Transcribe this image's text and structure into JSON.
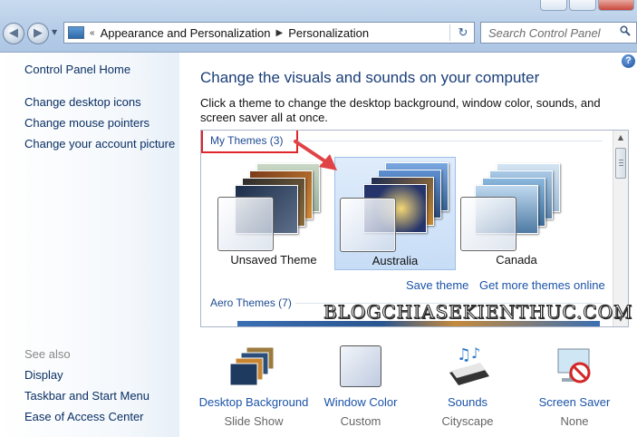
{
  "address": {
    "breadcrumb": [
      "Appearance and Personalization",
      "Personalization"
    ],
    "search_placeholder": "Search Control Panel"
  },
  "sidebar": {
    "home": "Control Panel Home",
    "links": [
      "Change desktop icons",
      "Change mouse pointers",
      "Change your account picture"
    ],
    "see_also_label": "See also",
    "see_also": [
      "Display",
      "Taskbar and Start Menu",
      "Ease of Access Center"
    ]
  },
  "main": {
    "title": "Change the visuals and sounds on your computer",
    "description": "Click a theme to change the desktop background, window color, sounds, and screen saver all at once."
  },
  "themes": {
    "my_themes_header": "My Themes (3)",
    "items": [
      {
        "name": "Unsaved Theme",
        "selected": false
      },
      {
        "name": "Australia",
        "selected": true
      },
      {
        "name": "Canada",
        "selected": false
      }
    ],
    "save_theme": "Save theme",
    "get_more": "Get more themes online",
    "aero_header": "Aero Themes (7)"
  },
  "watermark": "BLOGCHIASEKIENTHUC.COM",
  "customizations": [
    {
      "label": "Desktop Background",
      "value": "Slide Show",
      "icon": "desktop-background-icon"
    },
    {
      "label": "Window Color",
      "value": "Custom",
      "icon": "window-color-icon"
    },
    {
      "label": "Sounds",
      "value": "Cityscape",
      "icon": "sounds-icon"
    },
    {
      "label": "Screen Saver",
      "value": "None",
      "icon": "screen-saver-icon"
    }
  ],
  "colors": {
    "link": "#1b53a8",
    "title": "#1a3e78",
    "highlight_box": "#e0262a",
    "arrow": "#e04346",
    "selected_tile": "#c7ddf6"
  }
}
